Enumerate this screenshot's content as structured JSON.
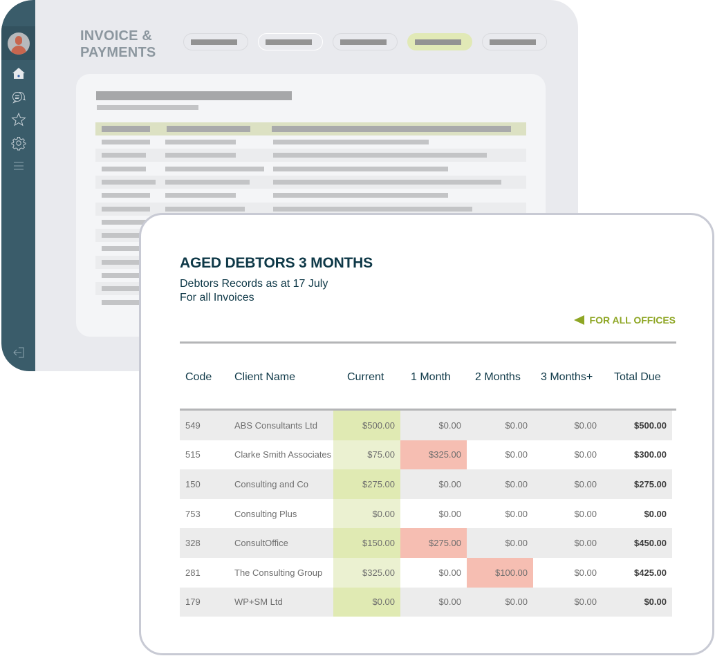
{
  "back_window": {
    "title_line1": "INVOICE &",
    "title_line2": "PAYMENTS",
    "sidebar": {
      "items": [
        {
          "icon": "avatar"
        },
        {
          "icon": "home-icon"
        },
        {
          "icon": "chat-icon"
        },
        {
          "icon": "star-icon"
        },
        {
          "icon": "gear-icon"
        },
        {
          "icon": "menu-icon"
        },
        {
          "icon": "logout-icon"
        }
      ]
    },
    "tabs_count": 5,
    "active_tab_index": 3
  },
  "report": {
    "title": "AGED DEBTORS 3 MONTHS",
    "subtitle_line1": "Debtors Records as at 17 July",
    "subtitle_line2": "For all Invoices",
    "filter_label": "FOR ALL OFFICES",
    "columns": [
      "Code",
      "Client Name",
      "Current",
      "1 Month",
      "2 Months",
      "3 Months+",
      "Total Due"
    ],
    "rows": [
      {
        "code": "549",
        "client": "ABS Consultants Ltd",
        "current": "$500.00",
        "m1": "$0.00",
        "m2": "$0.00",
        "m3": "$0.00",
        "total": "$500.00"
      },
      {
        "code": "515",
        "client": "Clarke Smith Associates",
        "current": "$75.00",
        "m1": "$325.00",
        "m2": "$0.00",
        "m3": "$0.00",
        "total": "$300.00"
      },
      {
        "code": "150",
        "client": "Consulting and Co",
        "current": "$275.00",
        "m1": "$0.00",
        "m2": "$0.00",
        "m3": "$0.00",
        "total": "$275.00"
      },
      {
        "code": "753",
        "client": "Consulting Plus",
        "current": "$0.00",
        "m1": "$0.00",
        "m2": "$0.00",
        "m3": "$0.00",
        "total": "$0.00"
      },
      {
        "code": "328",
        "client": "ConsultOffice",
        "current": "$150.00",
        "m1": "$275.00",
        "m2": "$0.00",
        "m3": "$0.00",
        "total": "$450.00"
      },
      {
        "code": "281",
        "client": "The Consulting Group",
        "current": "$325.00",
        "m1": "$0.00",
        "m2": "$100.00",
        "m3": "$0.00",
        "total": "$425.00"
      },
      {
        "code": "179",
        "client": "WP+SM Ltd",
        "current": "$0.00",
        "m1": "$0.00",
        "m2": "$0.00",
        "m3": "$0.00",
        "total": "$0.00"
      }
    ],
    "overdue_highlights": [
      {
        "row": 1,
        "column": "1 Month"
      },
      {
        "row": 4,
        "column": "1 Month"
      },
      {
        "row": 5,
        "column": "2 Months"
      }
    ],
    "colors": {
      "title": "#0e3847",
      "accent": "#8ea624",
      "current_highlight": "#e0eab3",
      "overdue_highlight": "#f6beb2",
      "sidebar": "#3a5c6a"
    }
  }
}
